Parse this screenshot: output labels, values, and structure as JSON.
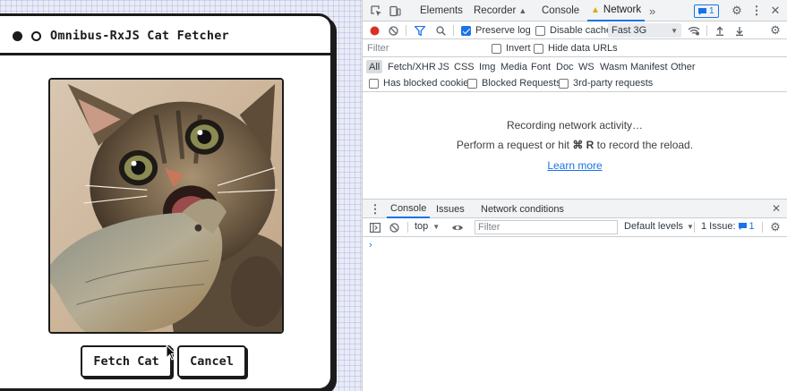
{
  "app": {
    "title": "Omnibus-RxJS Cat Fetcher",
    "image_alt": "kitten biting a fish",
    "buttons": {
      "fetch": "Fetch Cat",
      "cancel": "Cancel"
    }
  },
  "devtools": {
    "tabs": [
      {
        "label": "Elements"
      },
      {
        "label": "Recorder",
        "suffix": "▲"
      },
      {
        "label": "Console"
      },
      {
        "label": "Network",
        "warning": "▲"
      }
    ],
    "more_tabs": "»",
    "issues_badge": "1",
    "network": {
      "preserve_log": {
        "label": "Preserve log",
        "checked": true
      },
      "disable_cache": {
        "label": "Disable cache",
        "checked": false
      },
      "throttling": "Fast 3G",
      "filter_placeholder": "Filter",
      "invert": {
        "label": "Invert",
        "checked": false
      },
      "hide_data_urls": {
        "label": "Hide data URLs",
        "checked": false
      },
      "types": [
        "All",
        "Fetch/XHR",
        "JS",
        "CSS",
        "Img",
        "Media",
        "Font",
        "Doc",
        "WS",
        "Wasm",
        "Manifest",
        "Other"
      ],
      "has_blocked_cookies": "Has blocked cookies",
      "blocked_requests": "Blocked Requests",
      "third_party": "3rd-party requests",
      "empty_line1": "Recording network activity…",
      "empty_line2_pre": "Perform a request or hit",
      "empty_line2_keys": "⌘ R",
      "empty_line2_post": "to record the reload.",
      "learn_more": "Learn more"
    },
    "drawer": {
      "tabs": [
        "Console",
        "Issues",
        "Network conditions"
      ],
      "context": "top",
      "filter_placeholder": "Filter",
      "levels": "Default levels",
      "issues_label": "1 Issue:",
      "issues_count": "1",
      "prompt": "›"
    },
    "colors": {
      "accent": "#1a73e8",
      "record": "#d93025",
      "warning": "#e2a600"
    }
  }
}
